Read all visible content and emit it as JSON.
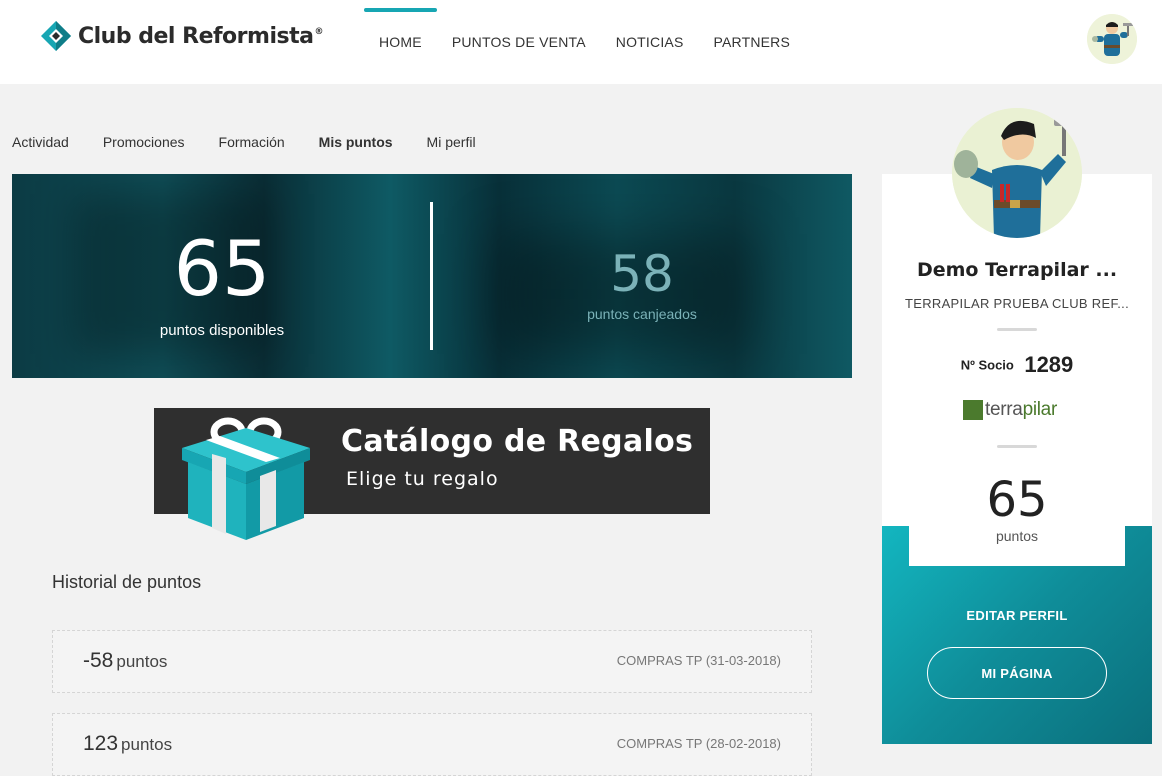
{
  "header": {
    "brand": "Club del Reformista",
    "brand_mark": "®",
    "nav": [
      {
        "label": "HOME",
        "active": true
      },
      {
        "label": "PUNTOS DE VENTA",
        "active": false
      },
      {
        "label": "NOTICIAS",
        "active": false
      },
      {
        "label": "PARTNERS",
        "active": false
      }
    ]
  },
  "subtabs": [
    {
      "label": "Actividad",
      "active": false
    },
    {
      "label": "Promociones",
      "active": false
    },
    {
      "label": "Formación",
      "active": false
    },
    {
      "label": "Mis puntos",
      "active": true
    },
    {
      "label": "Mi perfil",
      "active": false
    }
  ],
  "points": {
    "available": "65",
    "available_label": "puntos disponibles",
    "redeemed": "58",
    "redeemed_label": "puntos canjeados"
  },
  "catalog": {
    "title": "Catálogo de Regalos",
    "subtitle": "Elige tu regalo",
    "icon": "gift-icon"
  },
  "history": {
    "title": "Historial de puntos",
    "rows": [
      {
        "amount": "-58",
        "unit": "puntos",
        "desc": "COMPRAS TP (31-03-2018)"
      },
      {
        "amount": "123",
        "unit": "puntos",
        "desc": "COMPRAS TP (28-02-2018)"
      }
    ]
  },
  "profile": {
    "name": "Demo Terrapilar ...",
    "company": "TERRAPILAR PRUEBA CLUB REF...",
    "socio_label": "Nº Socio",
    "socio_number": "1289",
    "brand_a": "terra",
    "brand_b": "pilar",
    "points": "65",
    "points_label": "puntos",
    "edit_label": "EDITAR PERFIL",
    "page_label": "MI PÁGINA"
  },
  "colors": {
    "accent": "#17a6b3",
    "teal_dark": "#0b6f7c",
    "brand_green": "#4b7a2d",
    "catalog_bg": "#2f2f2f"
  }
}
